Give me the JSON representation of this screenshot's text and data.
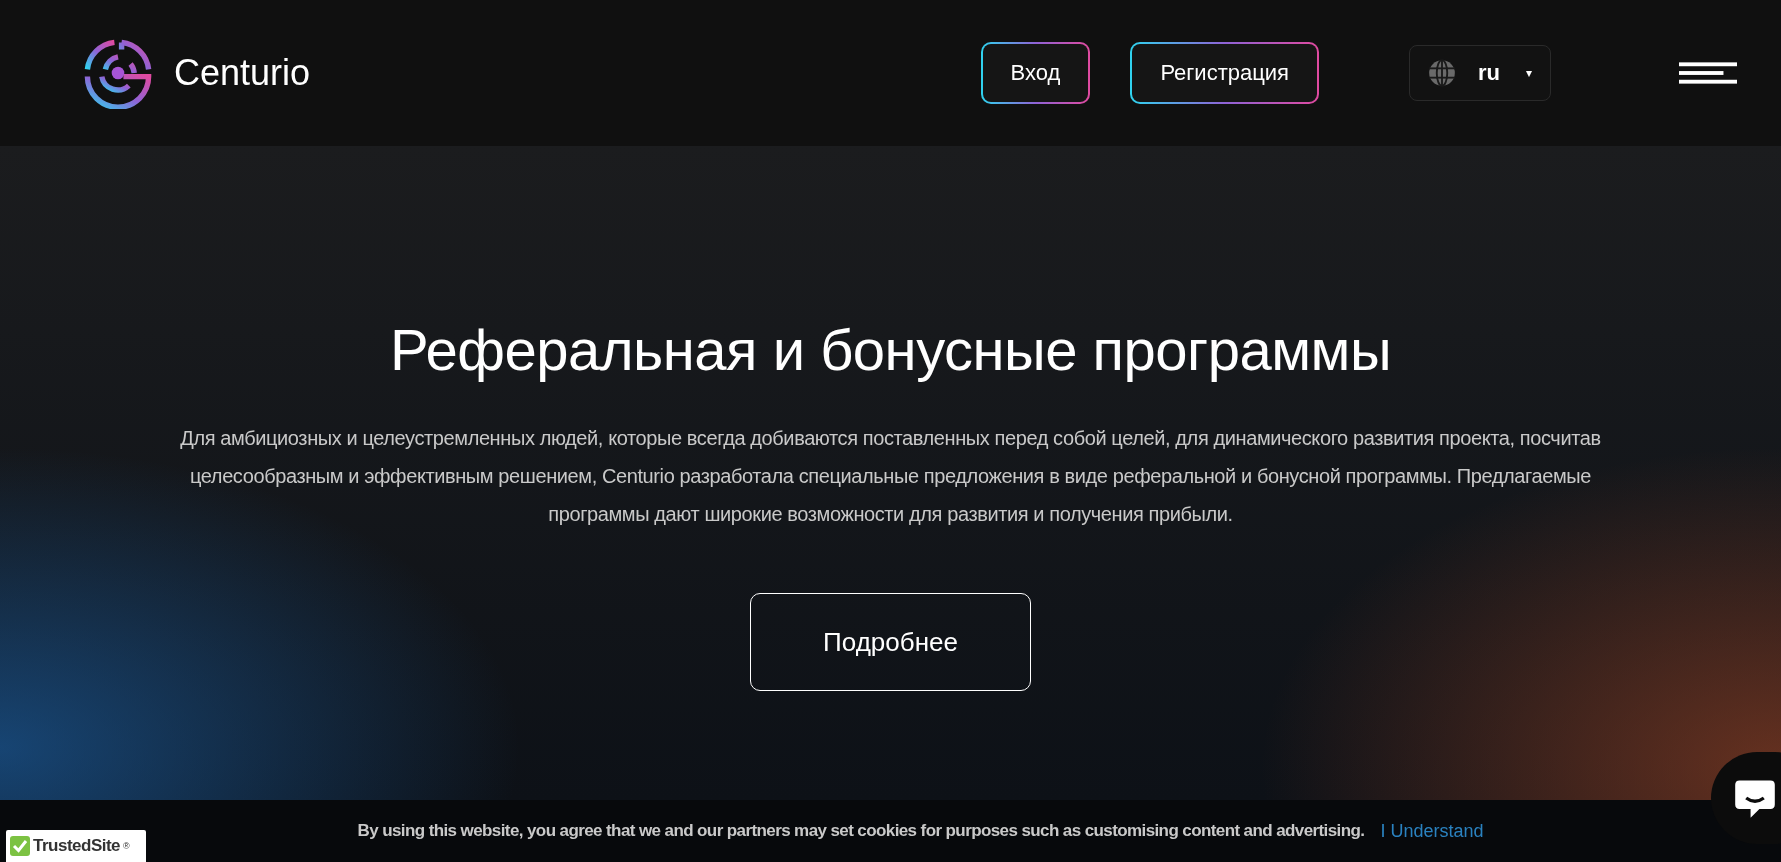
{
  "header": {
    "logo_text": "Centurio",
    "buttons": [
      {
        "label": "Вход"
      },
      {
        "label": "Регистрация"
      }
    ],
    "language": {
      "value": "ru",
      "caret": "▾"
    }
  },
  "hero": {
    "title": "Реферальная и бонусные программы",
    "text": "Для амбициозных и целеустремленных людей, которые всегда добиваются поставленных перед собой целей, для динамического развития проекта, посчитав целесообразным и эффективным решением, Centurio разработала специальные предложения в виде реферальной и бонусной программы. Предлагаемые программы дают широкие возможности для развития и получения прибыли.",
    "button": "Подробнее"
  },
  "cookie_bar": {
    "text": "By using this website, you agree that we and our partners may set cookies for purposes such as customising content and advertising.",
    "link": "I Understand"
  },
  "trust_badge": {
    "text": "TrustedSite",
    "mark": "®"
  }
}
